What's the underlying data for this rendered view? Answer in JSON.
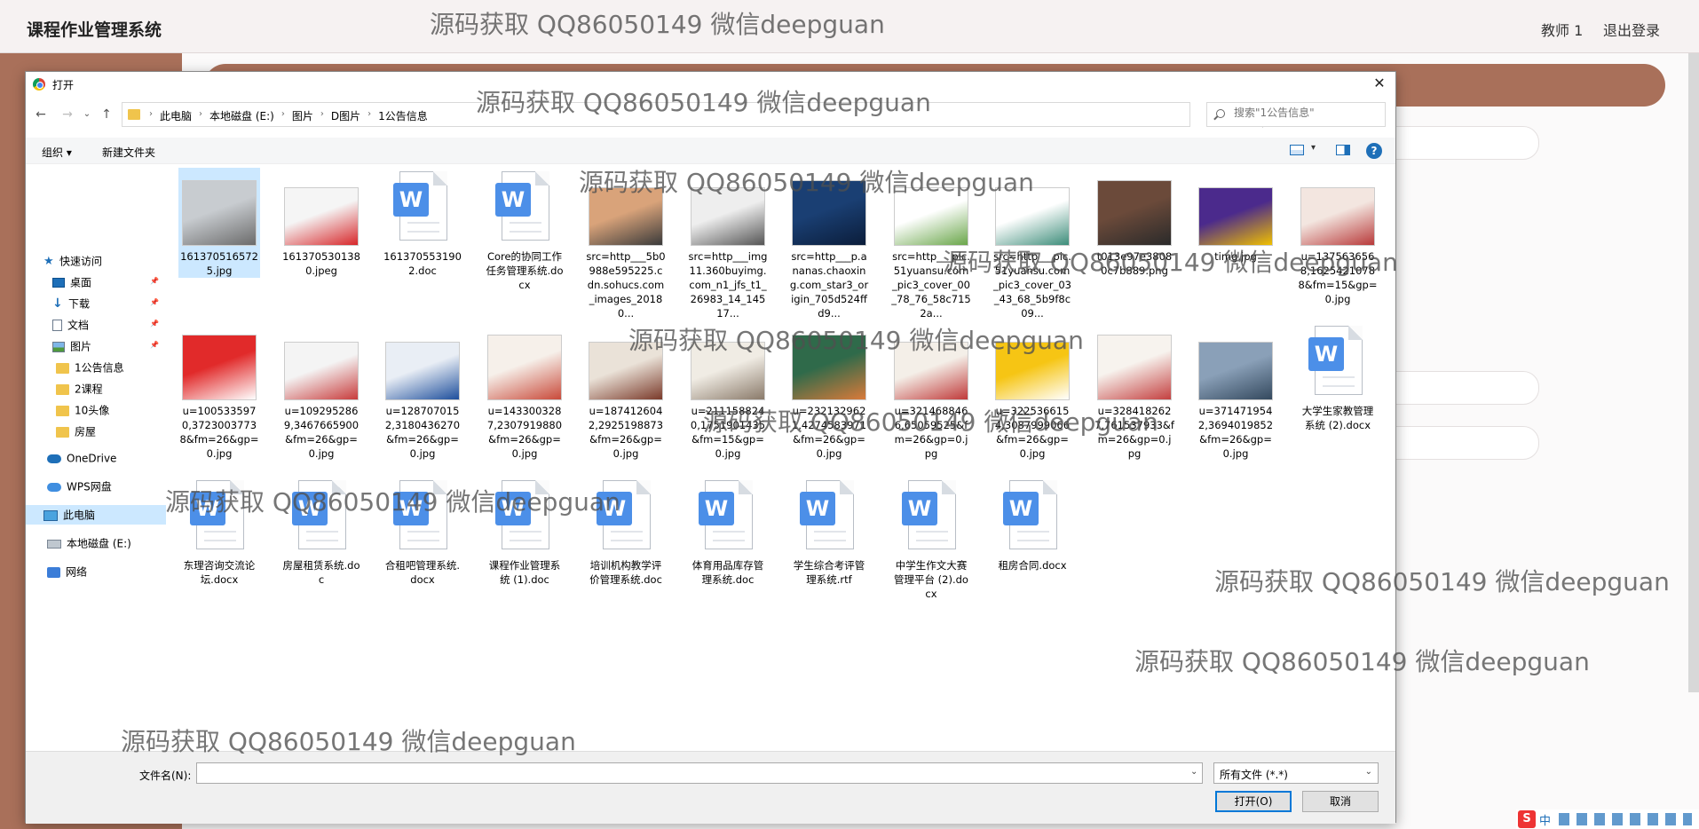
{
  "app": {
    "title": "课程作业管理系统",
    "user": "教师 1",
    "logout": "退出登录"
  },
  "dialog": {
    "title": "打开",
    "close": "✕",
    "breadcrumbs": [
      "此电脑",
      "本地磁盘 (E:)",
      "图片",
      "D图片",
      "1公告信息"
    ],
    "search_placeholder": "搜索\"1公告信息\"",
    "toolbar": {
      "organize": "组织 ▾",
      "new_folder": "新建文件夹",
      "help": "?"
    },
    "nav": [
      {
        "label": "快速访问",
        "icon": "star-icon"
      },
      {
        "label": "桌面",
        "icon": "desktop-icon",
        "pinned": true
      },
      {
        "label": "下载",
        "icon": "download-icon",
        "pinned": true
      },
      {
        "label": "文档",
        "icon": "documents-icon",
        "pinned": true
      },
      {
        "label": "图片",
        "icon": "pictures-icon",
        "pinned": true
      },
      {
        "label": "1公告信息",
        "icon": "folder-icon"
      },
      {
        "label": "2课程",
        "icon": "folder-icon"
      },
      {
        "label": "10头像",
        "icon": "folder-icon"
      },
      {
        "label": "房屋",
        "icon": "folder-icon"
      },
      {
        "label": "OneDrive",
        "icon": "onedrive-icon"
      },
      {
        "label": "WPS网盘",
        "icon": "wps-cloud-icon"
      },
      {
        "label": "此电脑",
        "icon": "this-pc-icon",
        "selected": true
      },
      {
        "label": "本地磁盘 (E:)",
        "icon": "drive-icon"
      },
      {
        "label": "网络",
        "icon": "network-icon"
      }
    ],
    "files": [
      {
        "name": "1613705165725.jpg",
        "kind": "img",
        "colors": [
          "#c8ccd0",
          "#6b6b6b"
        ],
        "selected": true
      },
      {
        "name": "1613705301380.jpeg",
        "kind": "img",
        "colors": [
          "#f5f5f5",
          "#d7272a"
        ]
      },
      {
        "name": "1613705531902.doc",
        "kind": "doc"
      },
      {
        "name": "Core的协同工作任务管理系统.docx",
        "kind": "doc"
      },
      {
        "name": "src=http___5b0988e595225.cdn.sohucs.com_images_20180...",
        "kind": "img",
        "colors": [
          "#d9a37a",
          "#3a3a3a"
        ]
      },
      {
        "name": "src=http___img11.360buyimg.com_n1_jfs_t1_26983_14_14517...",
        "kind": "img",
        "colors": [
          "#eeeeee",
          "#555555"
        ]
      },
      {
        "name": "src=http___p.ananas.chaoxing.com_star3_origin_705d524ffd9...",
        "kind": "img",
        "colors": [
          "#1a3f73",
          "#0b1d3a"
        ]
      },
      {
        "name": "src=http___pic.51yuansu.com_pic3_cover_00_78_76_58c7152a...",
        "kind": "img",
        "colors": [
          "#ffffff",
          "#6aa64a"
        ]
      },
      {
        "name": "src=http___pic.51yuansu.com_pic3_cover_03_43_68_5b9f8c09...",
        "kind": "img",
        "colors": [
          "#ffffff",
          "#3d8d7a"
        ]
      },
      {
        "name": "t013e97e38080c7b889.png",
        "kind": "img",
        "colors": [
          "#6b4a3a",
          "#2a2a2a"
        ]
      },
      {
        "name": "timg.jpg",
        "kind": "img",
        "colors": [
          "#4b2a8c",
          "#f0c000"
        ]
      },
      {
        "name": "u=1375636568,16254210788&fm=15&gp=0.jpg",
        "kind": "img",
        "colors": [
          "#f3e6e0",
          "#b83a3a"
        ]
      },
      {
        "name": "u=1005335970,37230037738&fm=26&gp=0.jpg",
        "kind": "img",
        "colors": [
          "#e12a2a",
          "#ffffff"
        ]
      },
      {
        "name": "u=1092952869,3467665900&fm=26&gp=0.jpg",
        "kind": "img",
        "colors": [
          "#f4f4f4",
          "#c83c3c"
        ]
      },
      {
        "name": "u=1287070152,3180436270&fm=26&gp=0.jpg",
        "kind": "img",
        "colors": [
          "#e9eef5",
          "#1e4f9c"
        ]
      },
      {
        "name": "u=1433003287,2307919880&fm=26&gp=0.jpg",
        "kind": "img",
        "colors": [
          "#f6f0ea",
          "#c94a3a"
        ]
      },
      {
        "name": "u=1874126042,2925198873&fm=26&gp=0.jpg",
        "kind": "img",
        "colors": [
          "#eae2d8",
          "#7a3a2a"
        ]
      },
      {
        "name": "u=2111588240,1751901435&fm=15&gp=0.jpg",
        "kind": "img",
        "colors": [
          "#f0ece4",
          "#8a7a6a"
        ]
      },
      {
        "name": "u=2321329621,4274583971&fm=26&gp=0.jpg",
        "kind": "img",
        "colors": [
          "#2f6a4a",
          "#d97a3a"
        ]
      },
      {
        "name": "u=3214688466,65059525&fm=26&gp=0.jpg",
        "kind": "img",
        "colors": [
          "#f4efe8",
          "#c03a3a"
        ]
      },
      {
        "name": "u=3225366154,3087999066&fm=26&gp=0.jpg",
        "kind": "img",
        "colors": [
          "#f6c514",
          "#ffffff"
        ]
      },
      {
        "name": "u=3284182627,761537933&fm=26&gp=0.jpg",
        "kind": "img",
        "colors": [
          "#f7f3ee",
          "#c44040"
        ]
      },
      {
        "name": "u=3714719542,3694019852&fm=26&gp=0.jpg",
        "kind": "img",
        "colors": [
          "#8aa0b8",
          "#34495e"
        ]
      },
      {
        "name": "大学生家教管理系统 (2).docx",
        "kind": "doc"
      },
      {
        "name": "东理咨询交流论坛.docx",
        "kind": "doc"
      },
      {
        "name": "房屋租赁系统.doc",
        "kind": "doc"
      },
      {
        "name": "合租吧管理系统.docx",
        "kind": "doc"
      },
      {
        "name": "课程作业管理系统 (1).doc",
        "kind": "doc"
      },
      {
        "name": "培训机构教学评价管理系统.doc",
        "kind": "doc"
      },
      {
        "name": "体育用品库存管理系统.doc",
        "kind": "doc"
      },
      {
        "name": "学生综合考评管理系统.rtf",
        "kind": "doc"
      },
      {
        "name": "中学生作文大赛管理平台 (2).docx",
        "kind": "doc"
      },
      {
        "name": "租房合同.docx",
        "kind": "doc"
      }
    ],
    "doc_letter": "W",
    "filename_label": "文件名(N):",
    "filename_value": "",
    "filetype": "所有文件 (*.*)",
    "open_button": "打开(O)",
    "cancel_button": "取消"
  },
  "ime": {
    "logo": "S",
    "mode": "中"
  },
  "watermark": "源码获取 QQ86050149 微信deepguan"
}
